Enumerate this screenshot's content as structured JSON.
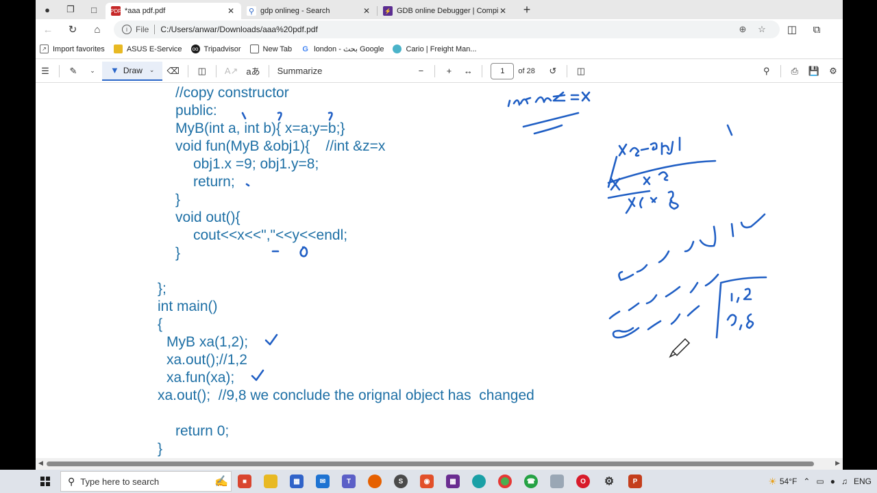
{
  "tabs": [
    {
      "title": "*aaa pdf.pdf",
      "icon": "pdf-icon",
      "active": true
    },
    {
      "title": "gdp onlineg - Search",
      "icon": "search-icon",
      "active": false
    },
    {
      "title": "GDB online Debugger | Compiler",
      "icon": "gdb-icon",
      "active": false
    }
  ],
  "address": {
    "scheme": "File",
    "url": "C:/Users/anwar/Downloads/aaa%20pdf.pdf"
  },
  "bookmarks": [
    {
      "label": "Import favorites",
      "icon": "import-icon"
    },
    {
      "label": "ASUS E-Service",
      "icon": "folder-icon"
    },
    {
      "label": "Tripadvisor",
      "icon": "tripadvisor-icon"
    },
    {
      "label": "New Tab",
      "icon": "page-icon"
    },
    {
      "label": "london - بحث Google",
      "icon": "google-icon"
    },
    {
      "label": "Cario | Freight Man...",
      "icon": "cario-icon"
    }
  ],
  "pdf_toolbar": {
    "draw_label": "Draw",
    "summarize_label": "Summarize",
    "page_value": "1",
    "page_total": "of 28"
  },
  "code_lines": [
    "//copy constructor",
    "public:",
    "MyB(int a, int b){ x=a;y=b;}",
    "void fun(MyB &obj1){    //int &z=x",
    "obj1.x =9; obj1.y=8;",
    "return;",
    "}",
    "void out(){",
    "cout<<x<<\",\"<<y<<endl;",
    "}",
    "};",
    "int main()",
    "{",
    "MyB xa(1,2);",
    "xa.out();//1,2",
    "xa.fun(xa);",
    "xa.out();  //9,8 we conclude the orignal object has  changed",
    "return 0;",
    "}"
  ],
  "taskbar": {
    "search_placeholder": "Type here to search",
    "temperature": "54°F",
    "language": "ENG"
  },
  "colors": {
    "code_text": "#1d6fa5",
    "ink": "#1f5ec4",
    "draw_accent": "#2a66c9"
  }
}
